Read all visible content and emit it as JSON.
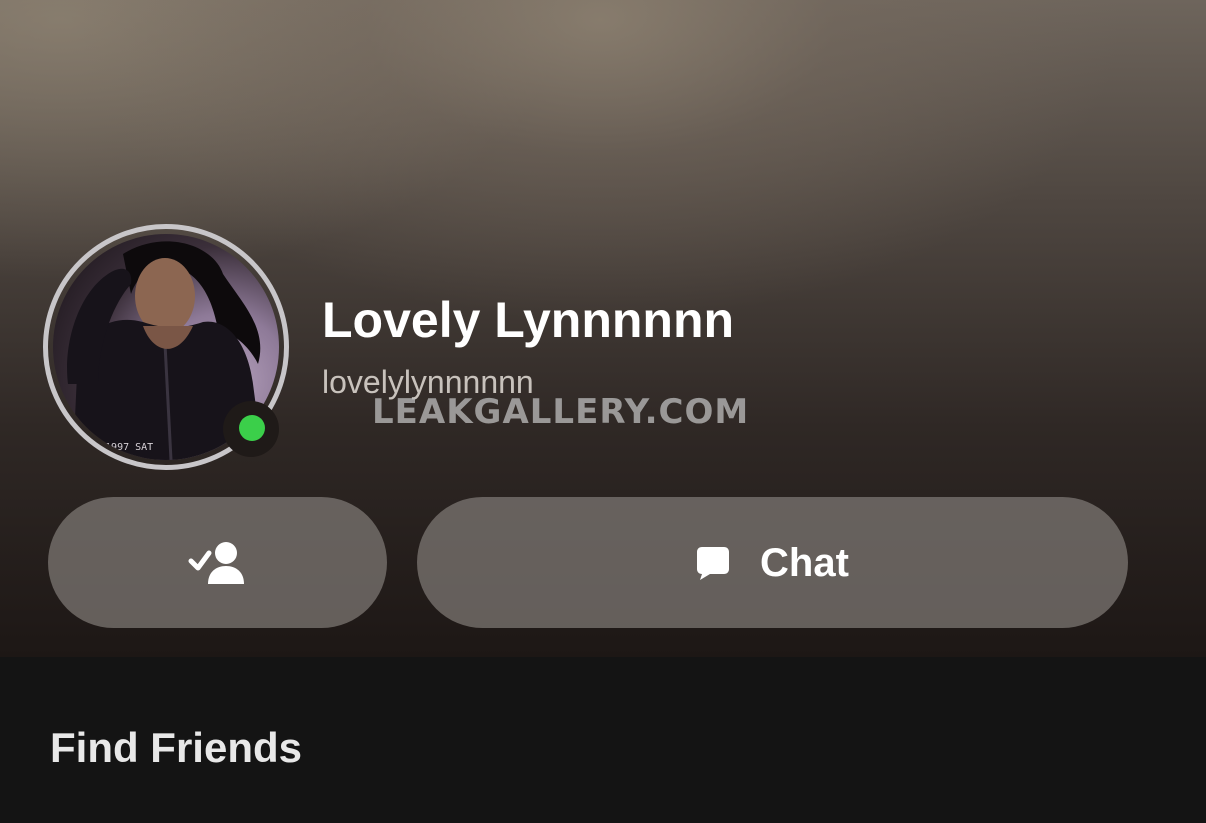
{
  "profile": {
    "display_name": "Lovely Lynnnnnn",
    "username": "lovelylynnnnnn",
    "online_status_color": "#3bcf4a",
    "avatar_icon": "profile-photo"
  },
  "actions": {
    "friend_icon": "friend-added-check-icon",
    "chat_icon": "chat-bubble-icon",
    "chat_label": "Chat"
  },
  "watermark": "LEAKGALLERY.COM",
  "section": {
    "title": "Find Friends"
  }
}
